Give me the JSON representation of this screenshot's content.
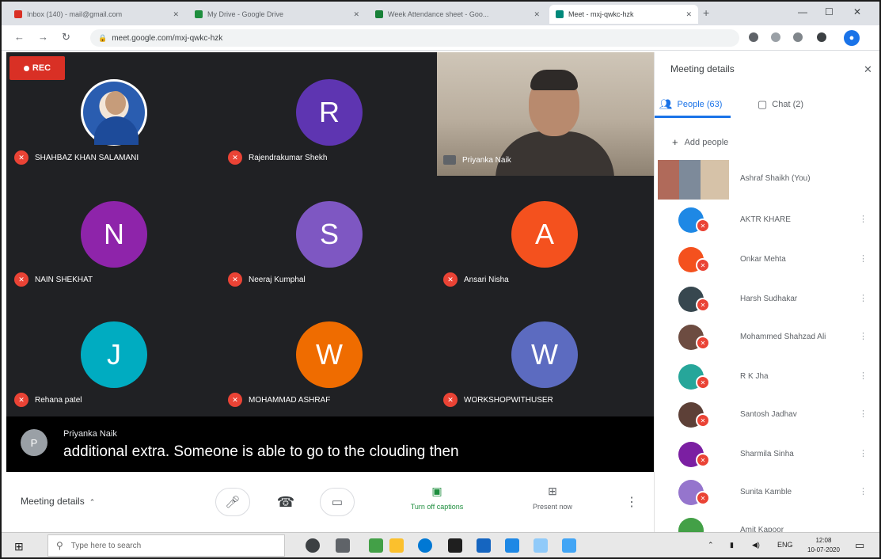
{
  "browser": {
    "tabs": [
      {
        "label": "Inbox (140) - mail@gmail.com",
        "color": "#d93025"
      },
      {
        "label": "My Drive - Google Drive",
        "color": "#1e8e3e"
      },
      {
        "label": "Week Attendance sheet - Goo...",
        "color": "#188038"
      },
      {
        "label": "Meet - mxj-qwkc-hzk",
        "color": "#00897b"
      }
    ],
    "new_tab": "+",
    "url": "meet.google.com/mxj-qwkc-hzk"
  },
  "recording_label": "REC",
  "tiles": [
    {
      "name": "SHAHBAZ KHAN SALAMANI",
      "initial": "",
      "color": ""
    },
    {
      "name": "Rajendrakumar Shekh",
      "initial": "R",
      "color": "#5e35b1"
    },
    {
      "name": "NAIN SHEKHAT",
      "initial": "N",
      "color": "#8e24aa"
    },
    {
      "name": "Neeraj Kumphal",
      "initial": "S",
      "color": "#7e57c2"
    },
    {
      "name": "Ansari Nisha",
      "initial": "A",
      "color": "#f4511e"
    },
    {
      "name": "Rehana patel",
      "initial": "J",
      "color": "#00acc1"
    },
    {
      "name": "MOHAMMAD ASHRAF",
      "initial": "W",
      "color": "#ef6c00"
    },
    {
      "name": "WORKSHOPWITHUSER",
      "initial": "W",
      "color": "#5c6bc0"
    }
  ],
  "presenter": {
    "name": "Priyanka Naik"
  },
  "caption": {
    "avatar_letter": "P",
    "speaker": "Priyanka Naik",
    "text": "additional extra. Someone is able to go to the clouding then"
  },
  "meetbar": {
    "details_label": "Meeting details",
    "captions_label": "Turn off captions",
    "present_label": "Present now"
  },
  "panel": {
    "title": "Meeting details",
    "people_tab": "People (63)",
    "chat_tab": "Chat (2)",
    "add_people": "Add people",
    "self_name": "Ashraf Shaikh (You)",
    "participants": [
      {
        "name": "AKTR KHARE",
        "color": "#1e88e5"
      },
      {
        "name": "Onkar Mehta",
        "color": "#f4511e"
      },
      {
        "name": "Harsh Sudhakar",
        "color": "#37474f"
      },
      {
        "name": "Mohammed Shahzad Ali",
        "color": "#6d4c41"
      },
      {
        "name": "R K Jha",
        "color": "#26a69a"
      },
      {
        "name": "Santosh Jadhav",
        "color": "#5d4037"
      },
      {
        "name": "Sharmila Sinha",
        "color": "#7b1fa2"
      },
      {
        "name": "Sunita Kamble",
        "color": "#9575cd"
      },
      {
        "name": "Amit Kapoor",
        "color": "#43a047"
      }
    ]
  },
  "taskbar": {
    "search_placeholder": "Type here to search",
    "time": "12:08",
    "date": "10-07-2020",
    "lang": "ENG"
  }
}
